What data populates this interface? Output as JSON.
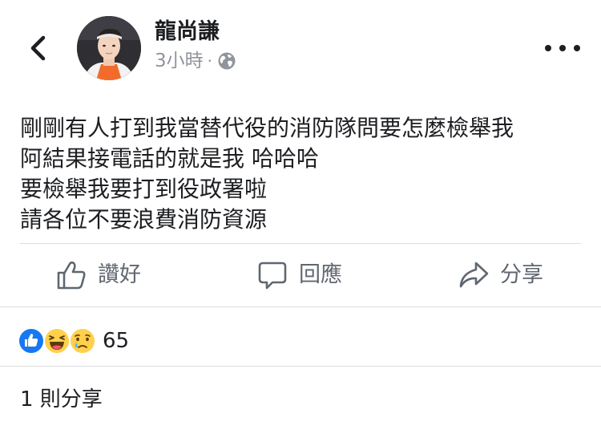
{
  "header": {
    "author_name": "龍尚謙",
    "timestamp": "3小時",
    "separator": "·",
    "privacy_icon": "globe-icon",
    "back_icon": "chevron-left-icon",
    "more_icon": "more-options-icon"
  },
  "post": {
    "lines": [
      "剛剛有人打到我當替代役的消防隊問要怎麼檢舉我",
      "阿結果接電話的就是我 哈哈哈",
      "要檢舉我要打到役政署啦",
      "請各位不要浪費消防資源"
    ]
  },
  "actions": {
    "like_label": "讚好",
    "comment_label": "回應",
    "share_label": "分享",
    "like_icon": "thumbs-up-icon",
    "comment_icon": "comment-bubble-icon",
    "share_icon": "share-arrow-icon"
  },
  "reactions": {
    "icons": [
      "like-reaction-icon",
      "haha-reaction-icon",
      "sad-reaction-icon"
    ],
    "count": "65"
  },
  "shares": {
    "text": "1 則分享"
  },
  "colors": {
    "text_primary": "#1c1e21",
    "text_secondary": "#606770",
    "meta_gray": "#90949c",
    "divider": "#dadde1",
    "like_blue": "#1877f2",
    "emoji_yellow": "#ffd04c"
  }
}
